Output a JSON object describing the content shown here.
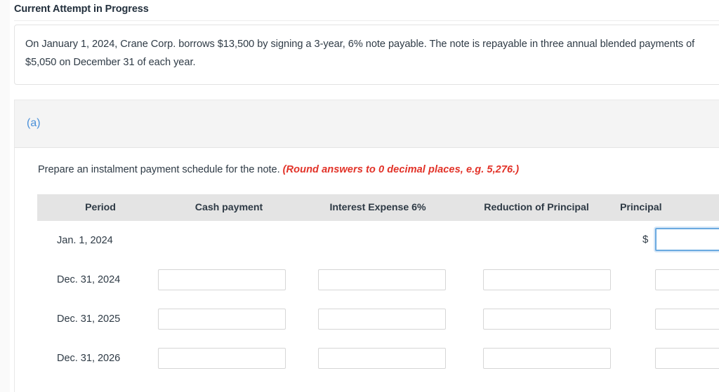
{
  "header": {
    "attempt_status": "Current Attempt in Progress"
  },
  "problem": {
    "text": "On January 1, 2024, Crane Corp. borrows $13,500 by signing a 3-year, 6% note payable. The note is repayable in three annual blended payments of $5,050 on December 31 of each year."
  },
  "part": {
    "label": "(a)",
    "instruction_main": "Prepare an instalment payment schedule for the note.",
    "instruction_note": "(Round answers to 0 decimal places, e.g. 5,276.)"
  },
  "table": {
    "columns": [
      "Period",
      "Cash payment",
      "Interest Expense 6%",
      "Reduction of Principal",
      "Principal"
    ],
    "rows": [
      {
        "period": "Jan. 1, 2024",
        "cash_payment": "",
        "interest_expense": "",
        "reduction_of_principal": "",
        "principal": "",
        "currency_symbol": "$",
        "show_currency": true,
        "show_cash_input": false,
        "show_interest_input": false,
        "show_reduction_input": false,
        "principal_focused": true
      },
      {
        "period": "Dec. 31, 2024",
        "cash_payment": "",
        "interest_expense": "",
        "reduction_of_principal": "",
        "principal": "",
        "currency_symbol": "",
        "show_currency": false,
        "show_cash_input": true,
        "show_interest_input": true,
        "show_reduction_input": true,
        "principal_focused": false
      },
      {
        "period": "Dec. 31, 2025",
        "cash_payment": "",
        "interest_expense": "",
        "reduction_of_principal": "",
        "principal": "",
        "currency_symbol": "",
        "show_currency": false,
        "show_cash_input": true,
        "show_interest_input": true,
        "show_reduction_input": true,
        "principal_focused": false
      },
      {
        "period": "Dec. 31, 2026",
        "cash_payment": "",
        "interest_expense": "",
        "reduction_of_principal": "",
        "principal": "",
        "currency_symbol": "",
        "show_currency": false,
        "show_cash_input": true,
        "show_interest_input": true,
        "show_reduction_input": true,
        "principal_focused": false
      }
    ]
  },
  "colors": {
    "part_label": "#4a90d9",
    "round_note": "#e23228",
    "header_band": "#e4e4e4",
    "part_band": "#f4f4f4",
    "focus_border": "#6aa9e0",
    "input_border": "#d6d6d6",
    "text": "#2f3b46"
  }
}
